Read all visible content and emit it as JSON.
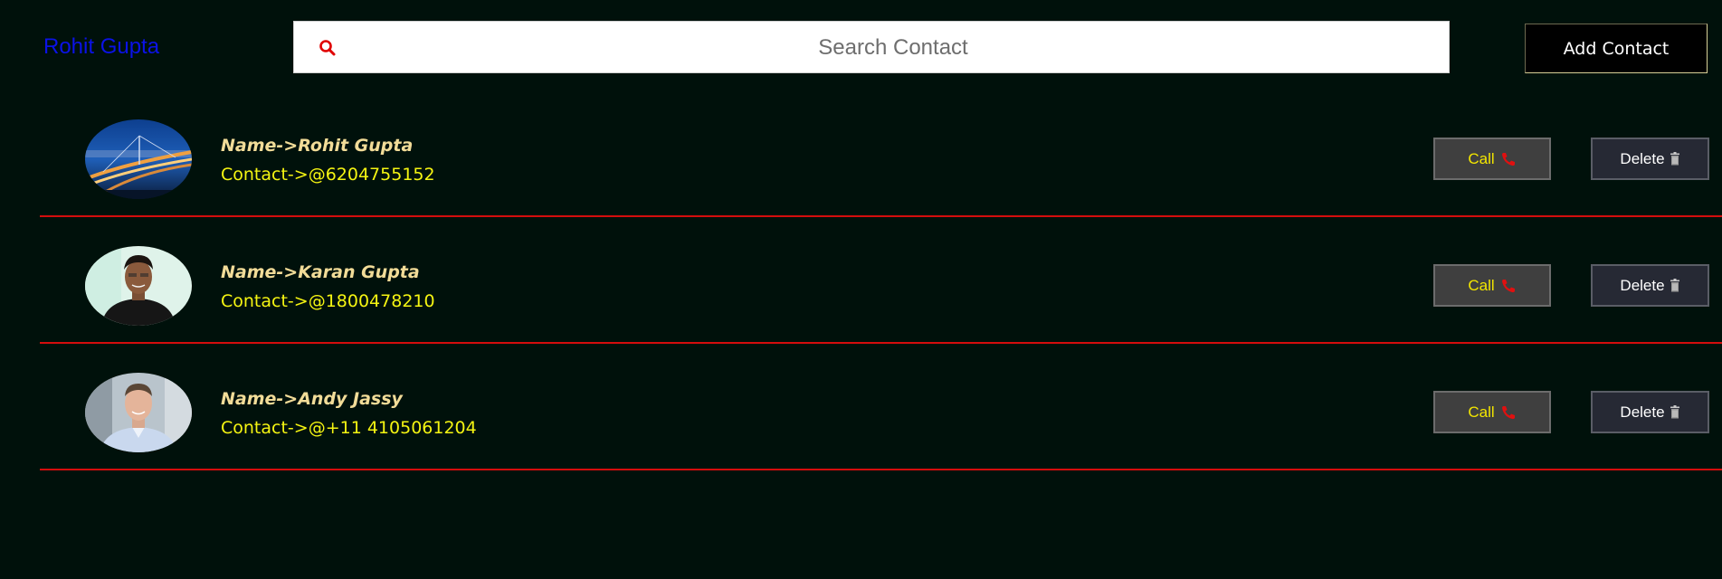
{
  "header": {
    "brand": "Rohit Gupta",
    "search_placeholder": "Search Contact",
    "search_value": "",
    "add_button_label": "Add Contact"
  },
  "contacts": [
    {
      "name": "Name->Rohit Gupta",
      "contact": "Contact->@6204755152",
      "avatar": "bridge-night-photo",
      "call_label": "Call",
      "delete_label": "Delete"
    },
    {
      "name": "Name->Karan Gupta",
      "contact": "Contact->@1800478210",
      "avatar": "person-photo",
      "call_label": "Call",
      "delete_label": "Delete"
    },
    {
      "name": "Name->Andy Jassy",
      "contact": "Contact->@+11 4105061204",
      "avatar": "person-photo",
      "call_label": "Call",
      "delete_label": "Delete"
    }
  ],
  "icons": {
    "search": "search-icon",
    "call": "phone-icon",
    "delete": "trash-icon"
  },
  "colors": {
    "background": "#00110b",
    "brand": "#0b12e6",
    "name_text": "#f2dc98",
    "contact_text": "#f5f512",
    "divider": "#d40d0d",
    "call_text": "#f3e600",
    "search_icon": "#e00000"
  }
}
